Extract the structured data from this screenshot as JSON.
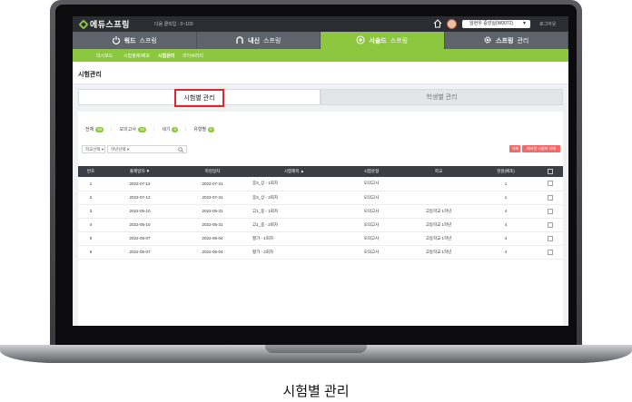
{
  "caption": "시험별 관리",
  "app": {
    "logo": "에듀스프링",
    "points": "다음 클릭입 : 0~100",
    "user_select": "임현우 중앙실(W0072)",
    "logout": "로그아웃"
  },
  "main_nav": [
    {
      "label": "워드",
      "suffix": "스프링",
      "icon": "power-icon",
      "active": false
    },
    {
      "label": "내신",
      "suffix": "스프링",
      "icon": "arch-icon",
      "active": false
    },
    {
      "label": "서술드",
      "suffix": "스프링",
      "icon": "spiral-icon",
      "active": true
    },
    {
      "label": "스프링",
      "suffix": "관리",
      "icon": "gear-icon",
      "active": false
    }
  ],
  "sub_nav": [
    "대시보드",
    "시험출제/배포",
    "시험관리",
    "라이브러리"
  ],
  "sub_nav_current": 2,
  "page_title": "시험관리",
  "sub_tabs": [
    "시험별 관리",
    "학생별 관리"
  ],
  "filters": [
    {
      "label": "전체",
      "count": "86"
    },
    {
      "label": "모의고사",
      "count": "15"
    },
    {
      "label": "세기",
      "count": "5"
    },
    {
      "label": "유형별",
      "count": "6"
    }
  ],
  "selects": {
    "school": "학교선택",
    "grade": "학년선택"
  },
  "buttons": {
    "delete": "삭제",
    "batch": "배포된 시험지 삭제"
  },
  "table": {
    "headers": [
      "번호",
      "출제일자",
      "마감일자",
      "시험제목",
      "시험유형",
      "학교",
      "현원(배포)"
    ],
    "rows": [
      {
        "no": "1",
        "start": "2022-07-12",
        "end": "2022-07-31",
        "title": "중3_상 - 1회차",
        "type": "모의고사",
        "school": "",
        "count": "1"
      },
      {
        "no": "2",
        "start": "2022-07-12",
        "end": "2022-07-31",
        "title": "중3_상 - 2회차",
        "type": "모의고사",
        "school": "",
        "count": "1"
      },
      {
        "no": "3",
        "start": "2022-05-10",
        "end": "2022-05-31",
        "title": "고1_중 - 1회차",
        "type": "모의고사",
        "school": "고등학교 1학년",
        "count": "4"
      },
      {
        "no": "4",
        "start": "2022-05-10",
        "end": "2022-05-31",
        "title": "고1_중 - 2회차",
        "type": "모의고사",
        "school": "고등학교 1학년",
        "count": "4"
      },
      {
        "no": "5",
        "start": "2022-05-07",
        "end": "2022-06-04",
        "title": "평가 - 1회차",
        "type": "모의고사",
        "school": "고등학교 1학년",
        "count": "4"
      },
      {
        "no": "6",
        "start": "2022-05-07",
        "end": "2022-06-04",
        "title": "평가 - 2회차",
        "type": "모의고사",
        "school": "고등학교 1학년",
        "count": "4"
      }
    ]
  },
  "colors": {
    "accent": "#8dc63f",
    "highlight": "#e0262d",
    "header": "#3b3e45"
  }
}
